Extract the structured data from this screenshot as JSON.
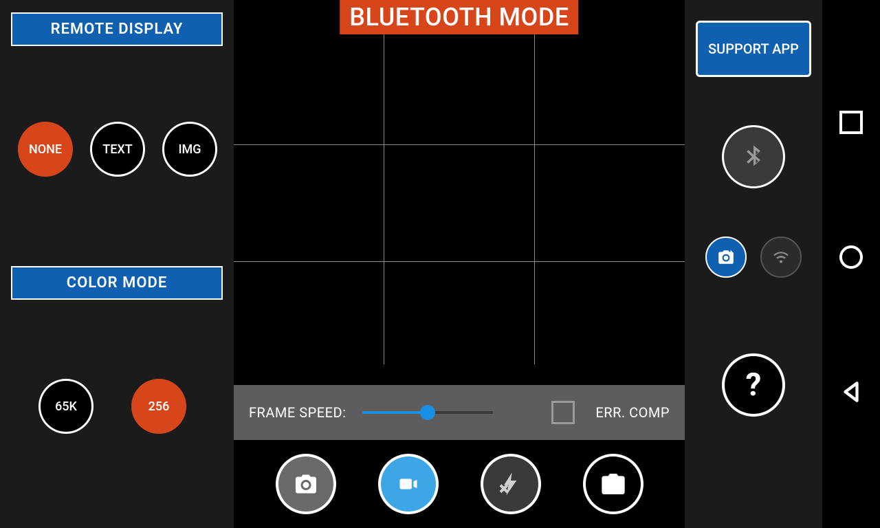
{
  "mode_banner": "BLUETOOTH MODE",
  "left": {
    "remote_display_header": "REMOTE DISPLAY",
    "color_mode_header": "COLOR MODE",
    "display_options": {
      "none": "NONE",
      "text": "TEXT",
      "img": "IMG"
    },
    "color_options": {
      "c65k": "65K",
      "c256": "256"
    }
  },
  "center": {
    "frame_speed_label": "FRAME SPEED:",
    "frame_speed_value_pct": 50,
    "err_comp_label": "ERR. COMP",
    "err_comp_checked": false
  },
  "right": {
    "support_label": "SUPPORT APP",
    "help_label": "?"
  },
  "icons": {
    "bluetooth": "bluetooth",
    "camera": "camera",
    "wifi": "wifi",
    "video": "video",
    "flash_off": "flash-off",
    "switch_cam": "switch-camera"
  },
  "colors": {
    "accent_blue": "#0f60b0",
    "accent_orange": "#d7451b",
    "slider_blue": "#1a8fe3"
  }
}
